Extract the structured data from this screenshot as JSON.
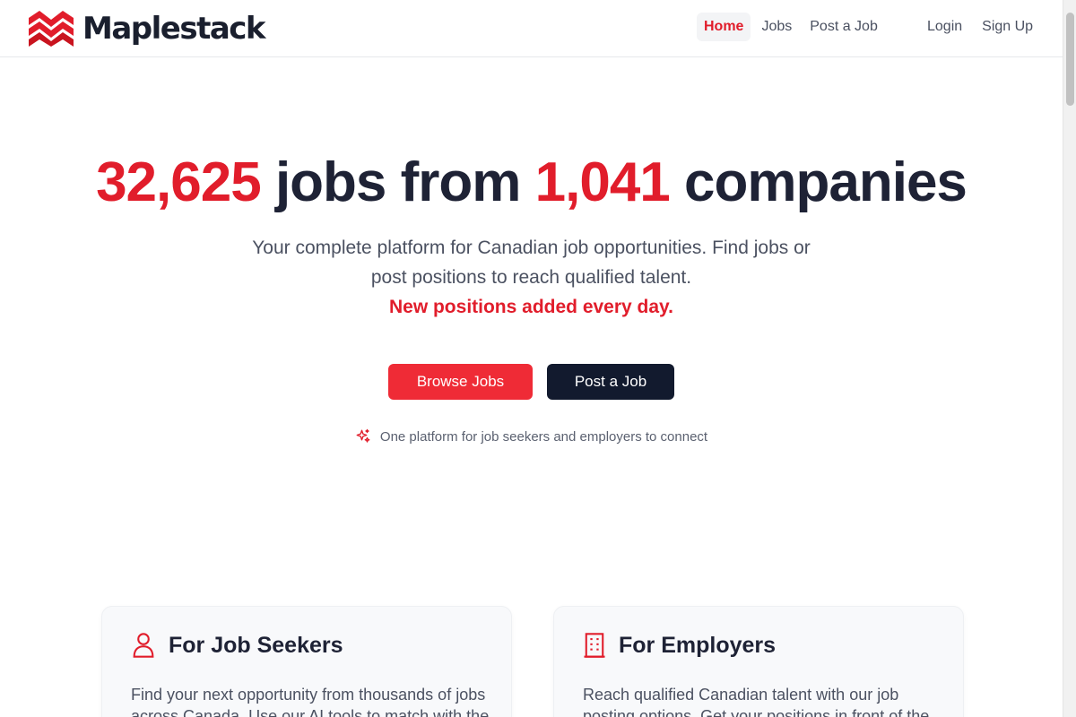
{
  "brand": {
    "name": "Maplestack",
    "accent": "#e11d2b",
    "dark": "#121a2e"
  },
  "nav": {
    "items": [
      {
        "label": "Home",
        "active": true
      },
      {
        "label": "Jobs",
        "active": false
      },
      {
        "label": "Post a Job",
        "active": false
      }
    ],
    "login": "Login",
    "signup": "Sign Up"
  },
  "hero": {
    "jobs_count": "32,625",
    "jobs_word": "jobs from",
    "companies_count": "1,041",
    "companies_word": "companies",
    "subtitle_line1": "Your complete platform for Canadian job opportunities. Find jobs or",
    "subtitle_line2": "post positions to reach qualified talent.",
    "highlight": "New positions added every day.",
    "primary_button": "Browse Jobs",
    "secondary_button": "Post a Job",
    "tagline": "One platform for job seekers and employers to connect",
    "tagline_icon": "sparkles-icon"
  },
  "cards": [
    {
      "icon": "user-icon",
      "title": "For Job Seekers",
      "body": "Find your next opportunity from thousands of jobs across Canada. Use our AI tools to match with the"
    },
    {
      "icon": "building-icon",
      "title": "For Employers",
      "body": "Reach qualified Canadian talent with our job posting options. Get your positions in front of the right"
    }
  ]
}
